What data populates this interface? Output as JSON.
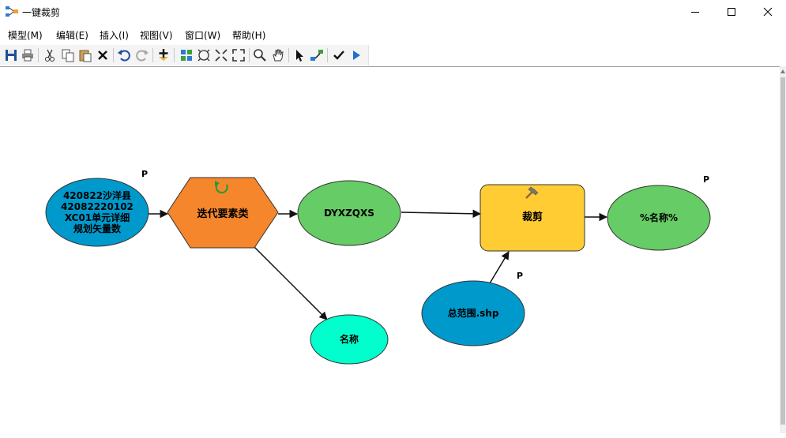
{
  "window": {
    "title": "一键裁剪"
  },
  "menu": [
    {
      "label": "模型(M)"
    },
    {
      "label": "编辑(E)"
    },
    {
      "label": "插入(I)"
    },
    {
      "label": "视图(V)"
    },
    {
      "label": "窗口(W)"
    },
    {
      "label": "帮助(H)"
    }
  ],
  "toolbar": [
    {
      "icon": "save-icon"
    },
    {
      "icon": "print-icon"
    },
    {
      "icon": "cut-icon"
    },
    {
      "icon": "copy-icon"
    },
    {
      "icon": "paste-icon"
    },
    {
      "icon": "delete-icon"
    },
    {
      "icon": "undo-icon"
    },
    {
      "icon": "redo-icon"
    },
    {
      "icon": "add-data-icon"
    },
    {
      "icon": "auto-layout-icon"
    },
    {
      "icon": "full-extent-icon"
    },
    {
      "icon": "fixed-zoom-in-icon"
    },
    {
      "icon": "fixed-zoom-out-icon"
    },
    {
      "icon": "zoom-icon"
    },
    {
      "icon": "pan-icon"
    },
    {
      "icon": "select-icon"
    },
    {
      "icon": "add-connection-icon"
    },
    {
      "icon": "validate-icon"
    },
    {
      "icon": "run-icon"
    }
  ],
  "model": {
    "input_dataset": {
      "lines": [
        "420822沙洋县",
        "42082220102",
        "XC01单元详细",
        "规划矢量数"
      ],
      "param_flag": "P",
      "color": "#0099cc"
    },
    "iterator": {
      "label": "迭代要素类",
      "color": "#f5862b"
    },
    "dyxzqxs": {
      "label": "DYXZQXS",
      "color": "#66cc66"
    },
    "name_value": {
      "label": "名称",
      "color": "#00ffcc"
    },
    "clip_tool": {
      "label": "裁剪",
      "color": "#ffcc33"
    },
    "extent_input": {
      "label": "总范围.shp",
      "param_flag": "P",
      "color": "#0099cc"
    },
    "output": {
      "label": "%名称%",
      "param_flag": "P",
      "color": "#66cc66"
    }
  }
}
